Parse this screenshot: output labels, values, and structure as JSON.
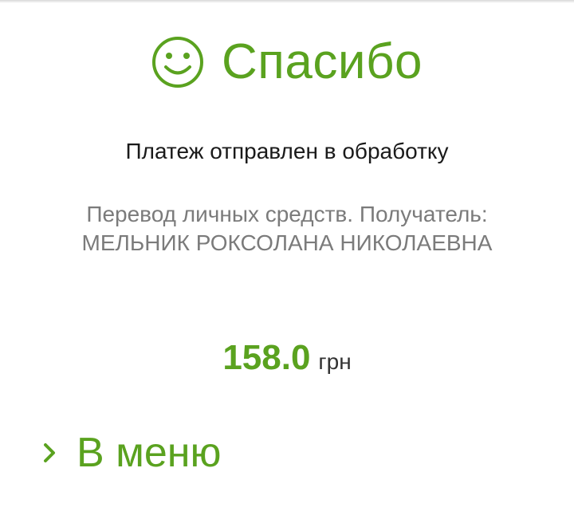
{
  "header": {
    "icon": "smile-icon",
    "title": "Спасибо"
  },
  "status": {
    "message": "Платеж отправлен в обработку"
  },
  "details": {
    "line1": "Перевод личных средств. Получатель:",
    "line2": "МЕЛЬНИК РОКСОЛАНА НИКОЛАЕВНА"
  },
  "payment": {
    "amount": "158.0",
    "currency": "грн"
  },
  "navigation": {
    "icon": "chevron-right-icon",
    "menu_label": "В меню"
  },
  "colors": {
    "accent": "#5aa21f",
    "secondary_text": "#7b7b7b",
    "primary_text": "#1a1a1a"
  }
}
